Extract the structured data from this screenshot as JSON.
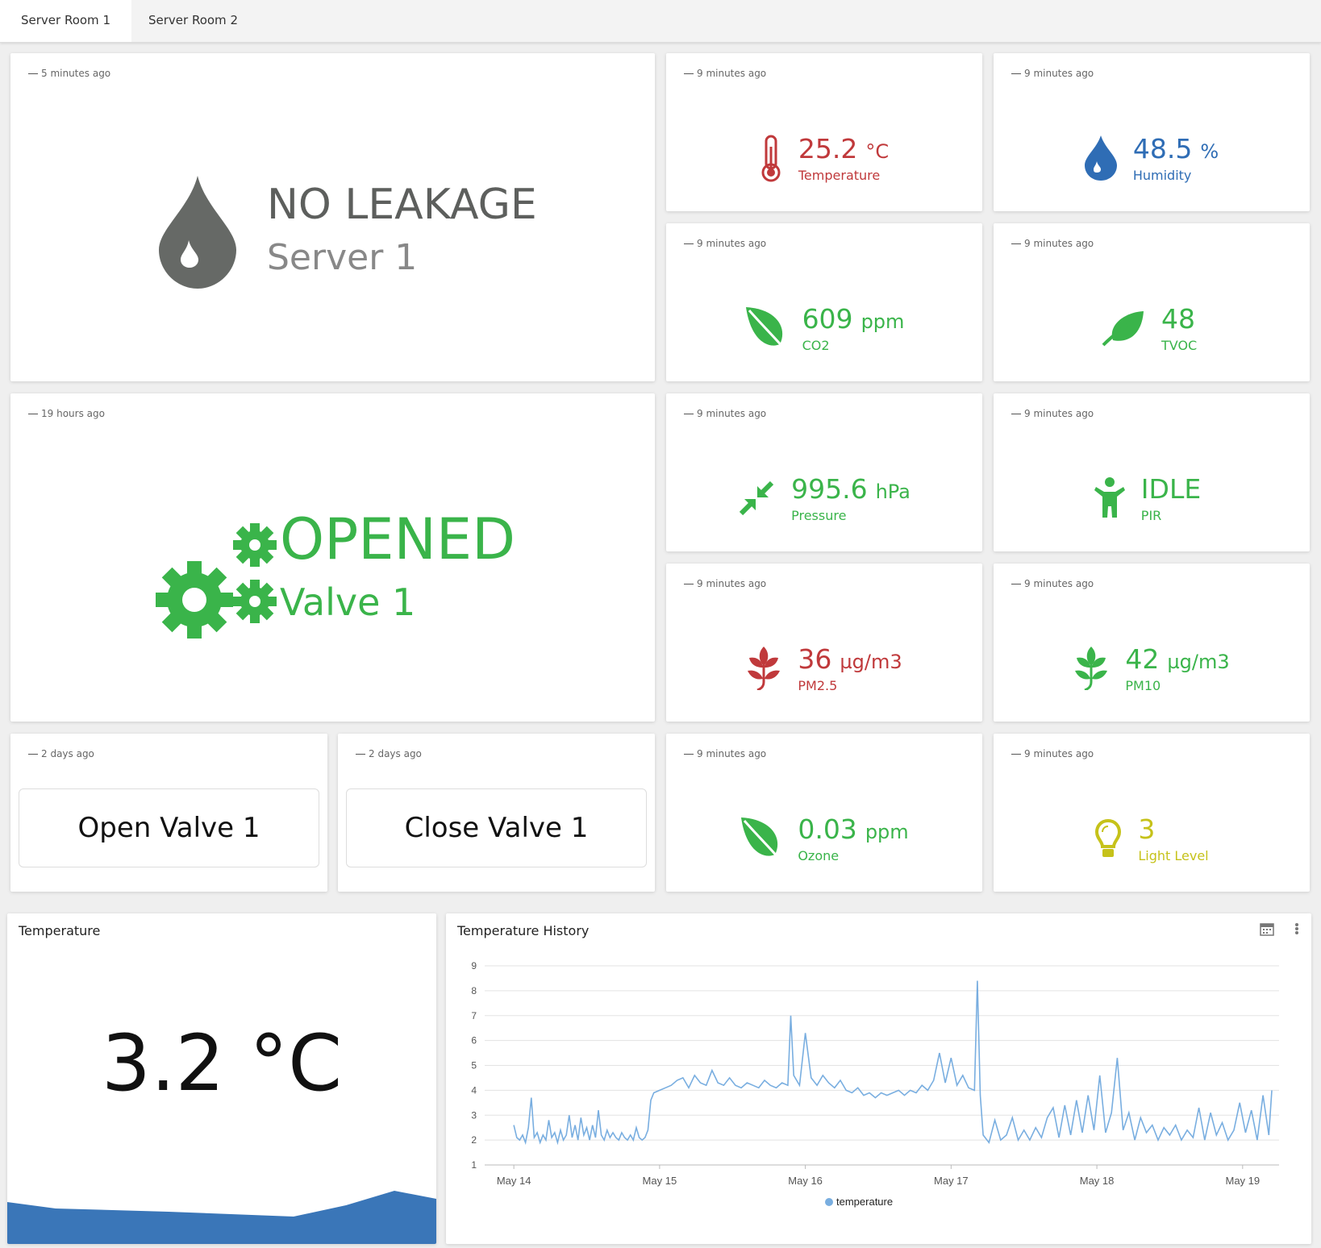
{
  "tabs": [
    {
      "label": "Server Room 1"
    },
    {
      "label": "Server Room 2"
    }
  ],
  "leak": {
    "ago": "5 minutes ago",
    "status": "NO LEAKAGE",
    "name": "Server 1"
  },
  "valve": {
    "ago": "19 hours ago",
    "status": "OPENED",
    "name": "Valve 1"
  },
  "sensors": [
    {
      "ago": "9 minutes ago",
      "value": "25.2",
      "unit": "°C",
      "label": "Temperature",
      "color": "#c0393b",
      "icon": "thermometer-icon"
    },
    {
      "ago": "9 minutes ago",
      "value": "48.5",
      "unit": "%",
      "label": "Humidity",
      "color": "#2f6db5",
      "icon": "water-drop-icon"
    },
    {
      "ago": "9 minutes ago",
      "value": "609",
      "unit": "ppm",
      "label": "CO2",
      "color": "#3ab44a",
      "icon": "leaf-icon"
    },
    {
      "ago": "9 minutes ago",
      "value": "48",
      "unit": "",
      "label": "TVOC",
      "color": "#3ab44a",
      "icon": "leaf-icon"
    },
    {
      "ago": "9 minutes ago",
      "value": "995.6",
      "unit": "hPa",
      "label": "Pressure",
      "color": "#3ab44a",
      "icon": "compress-arrows-icon"
    },
    {
      "ago": "9 minutes ago",
      "value": "IDLE",
      "unit": "",
      "label": "PIR",
      "color": "#3ab44a",
      "icon": "person-icon"
    },
    {
      "ago": "9 minutes ago",
      "value": "36",
      "unit": "µg/m3",
      "label": "PM2.5",
      "color": "#c0393b",
      "icon": "plant-icon"
    },
    {
      "ago": "9 minutes ago",
      "value": "42",
      "unit": "µg/m3",
      "label": "PM10",
      "color": "#3ab44a",
      "icon": "plant-icon"
    },
    {
      "ago": "9 minutes ago",
      "value": "0.03",
      "unit": "ppm",
      "label": "Ozone",
      "color": "#3ab44a",
      "icon": "leaf-icon"
    },
    {
      "ago": "9 minutes ago",
      "value": "3",
      "unit": "",
      "label": "Light Level",
      "color": "#c6c21a",
      "icon": "lightbulb-icon"
    }
  ],
  "buttons": [
    {
      "ago": "2 days ago",
      "label": "Open Valve 1"
    },
    {
      "ago": "2 days ago",
      "label": "Close Valve 1"
    }
  ],
  "temp_panel": {
    "title": "Temperature",
    "value": "3.2 °C",
    "fill_color": "#3a76b8"
  },
  "history": {
    "title": "Temperature History",
    "icons": [
      "calendar-icon",
      "more-vert-icon"
    ]
  },
  "chart_data": {
    "type": "line",
    "title": "Temperature History",
    "xlabel": "",
    "ylabel": "",
    "x_ticks": [
      "May 14",
      "May 15",
      "May 16",
      "May 17",
      "May 18",
      "May 19"
    ],
    "y_ticks": [
      1,
      2,
      3,
      4,
      5,
      6,
      7,
      8,
      9
    ],
    "ylim": [
      1,
      9
    ],
    "grid": true,
    "legend": "bottom",
    "series": [
      {
        "name": "temperature",
        "color": "#79aee0",
        "values": [
          [
            0.0,
            2.6
          ],
          [
            0.02,
            2.1
          ],
          [
            0.04,
            2.0
          ],
          [
            0.06,
            2.2
          ],
          [
            0.08,
            1.9
          ],
          [
            0.1,
            2.5
          ],
          [
            0.12,
            3.7
          ],
          [
            0.14,
            2.1
          ],
          [
            0.16,
            2.3
          ],
          [
            0.18,
            1.9
          ],
          [
            0.2,
            2.2
          ],
          [
            0.22,
            2.0
          ],
          [
            0.24,
            2.8
          ],
          [
            0.26,
            2.1
          ],
          [
            0.28,
            2.3
          ],
          [
            0.3,
            1.9
          ],
          [
            0.32,
            2.4
          ],
          [
            0.34,
            2.0
          ],
          [
            0.36,
            2.2
          ],
          [
            0.38,
            3.0
          ],
          [
            0.4,
            2.1
          ],
          [
            0.42,
            2.6
          ],
          [
            0.44,
            2.0
          ],
          [
            0.46,
            2.9
          ],
          [
            0.48,
            2.2
          ],
          [
            0.5,
            2.5
          ],
          [
            0.52,
            2.0
          ],
          [
            0.54,
            2.6
          ],
          [
            0.56,
            2.1
          ],
          [
            0.58,
            3.2
          ],
          [
            0.6,
            2.2
          ],
          [
            0.62,
            2.0
          ],
          [
            0.64,
            2.4
          ],
          [
            0.66,
            2.1
          ],
          [
            0.68,
            2.3
          ],
          [
            0.7,
            2.1
          ],
          [
            0.72,
            2.0
          ],
          [
            0.74,
            2.3
          ],
          [
            0.76,
            2.1
          ],
          [
            0.78,
            2.0
          ],
          [
            0.8,
            2.2
          ],
          [
            0.82,
            2.0
          ],
          [
            0.84,
            2.5
          ],
          [
            0.86,
            2.1
          ],
          [
            0.88,
            2.0
          ],
          [
            0.9,
            2.1
          ],
          [
            0.92,
            2.4
          ],
          [
            0.94,
            3.6
          ],
          [
            0.96,
            3.9
          ],
          [
            1.0,
            4.0
          ],
          [
            1.04,
            4.1
          ],
          [
            1.08,
            4.2
          ],
          [
            1.12,
            4.4
          ],
          [
            1.16,
            4.5
          ],
          [
            1.2,
            4.1
          ],
          [
            1.24,
            4.6
          ],
          [
            1.28,
            4.3
          ],
          [
            1.32,
            4.2
          ],
          [
            1.36,
            4.8
          ],
          [
            1.4,
            4.3
          ],
          [
            1.44,
            4.2
          ],
          [
            1.48,
            4.5
          ],
          [
            1.52,
            4.2
          ],
          [
            1.56,
            4.1
          ],
          [
            1.6,
            4.3
          ],
          [
            1.64,
            4.2
          ],
          [
            1.68,
            4.1
          ],
          [
            1.72,
            4.4
          ],
          [
            1.76,
            4.2
          ],
          [
            1.8,
            4.1
          ],
          [
            1.84,
            4.3
          ],
          [
            1.88,
            4.2
          ],
          [
            1.9,
            7.0
          ],
          [
            1.92,
            4.6
          ],
          [
            1.96,
            4.2
          ],
          [
            2.0,
            6.3
          ],
          [
            2.04,
            4.5
          ],
          [
            2.08,
            4.2
          ],
          [
            2.12,
            4.6
          ],
          [
            2.16,
            4.3
          ],
          [
            2.2,
            4.1
          ],
          [
            2.24,
            4.4
          ],
          [
            2.28,
            4.0
          ],
          [
            2.32,
            3.9
          ],
          [
            2.36,
            4.1
          ],
          [
            2.4,
            3.8
          ],
          [
            2.44,
            3.9
          ],
          [
            2.48,
            3.7
          ],
          [
            2.52,
            3.9
          ],
          [
            2.56,
            3.8
          ],
          [
            2.6,
            3.9
          ],
          [
            2.64,
            4.0
          ],
          [
            2.68,
            3.8
          ],
          [
            2.72,
            4.0
          ],
          [
            2.76,
            3.9
          ],
          [
            2.8,
            4.2
          ],
          [
            2.84,
            4.0
          ],
          [
            2.88,
            4.4
          ],
          [
            2.92,
            5.5
          ],
          [
            2.96,
            4.3
          ],
          [
            3.0,
            5.3
          ],
          [
            3.04,
            4.2
          ],
          [
            3.08,
            4.6
          ],
          [
            3.12,
            4.1
          ],
          [
            3.16,
            4.0
          ],
          [
            3.18,
            8.4
          ],
          [
            3.2,
            3.8
          ],
          [
            3.22,
            2.2
          ],
          [
            3.26,
            1.9
          ],
          [
            3.3,
            2.8
          ],
          [
            3.34,
            2.0
          ],
          [
            3.38,
            2.2
          ],
          [
            3.42,
            2.9
          ],
          [
            3.46,
            2.0
          ],
          [
            3.5,
            2.4
          ],
          [
            3.54,
            2.0
          ],
          [
            3.58,
            2.5
          ],
          [
            3.62,
            2.1
          ],
          [
            3.66,
            2.9
          ],
          [
            3.7,
            3.3
          ],
          [
            3.74,
            2.1
          ],
          [
            3.78,
            3.4
          ],
          [
            3.82,
            2.2
          ],
          [
            3.86,
            3.6
          ],
          [
            3.9,
            2.3
          ],
          [
            3.94,
            3.8
          ],
          [
            3.98,
            2.4
          ],
          [
            4.02,
            4.6
          ],
          [
            4.06,
            2.3
          ],
          [
            4.1,
            3.1
          ],
          [
            4.14,
            5.3
          ],
          [
            4.18,
            2.4
          ],
          [
            4.22,
            3.1
          ],
          [
            4.26,
            2.0
          ],
          [
            4.3,
            2.9
          ],
          [
            4.34,
            2.3
          ],
          [
            4.38,
            2.6
          ],
          [
            4.42,
            2.0
          ],
          [
            4.46,
            2.5
          ],
          [
            4.5,
            2.2
          ],
          [
            4.54,
            2.6
          ],
          [
            4.58,
            2.0
          ],
          [
            4.62,
            2.4
          ],
          [
            4.66,
            2.1
          ],
          [
            4.7,
            3.3
          ],
          [
            4.74,
            2.0
          ],
          [
            4.78,
            3.1
          ],
          [
            4.82,
            2.2
          ],
          [
            4.86,
            2.7
          ],
          [
            4.9,
            2.0
          ],
          [
            4.94,
            2.4
          ],
          [
            4.98,
            3.5
          ],
          [
            5.02,
            2.3
          ],
          [
            5.06,
            3.2
          ],
          [
            5.1,
            2.0
          ],
          [
            5.14,
            3.8
          ],
          [
            5.18,
            2.2
          ],
          [
            5.2,
            4.0
          ]
        ]
      }
    ]
  }
}
